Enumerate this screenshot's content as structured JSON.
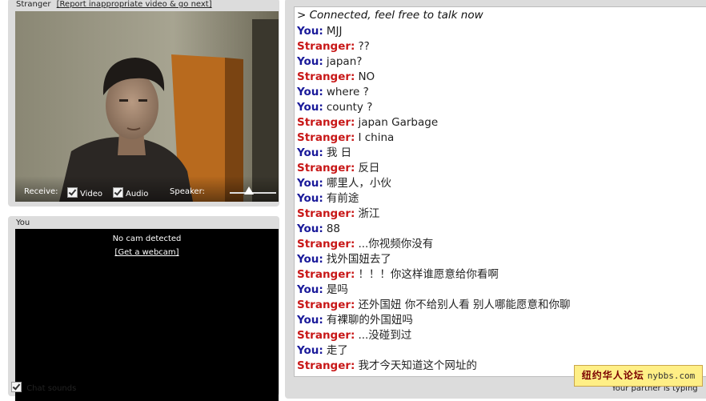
{
  "stranger_panel": {
    "label": "Stranger",
    "report_link": "[Report inappropriate video & go next]",
    "controls": {
      "receive_label": "Receive:",
      "video_label": "Video",
      "video_checked": true,
      "audio_label": "Audio",
      "audio_checked": true,
      "speaker_label": "Speaker:",
      "speaker_level": 0.4
    }
  },
  "you_panel": {
    "label": "You",
    "no_cam_text": "No cam detected",
    "webcam_link": "[Get a webcam]"
  },
  "chat": {
    "status": "> Connected, feel free to talk now",
    "messages": [
      {
        "sender": "You:",
        "role": "you",
        "text": "MJJ"
      },
      {
        "sender": "Stranger:",
        "role": "stranger",
        "text": "??"
      },
      {
        "sender": "You:",
        "role": "you",
        "text": "japan?"
      },
      {
        "sender": "Stranger:",
        "role": "stranger",
        "text": "NO"
      },
      {
        "sender": "You:",
        "role": "you",
        "text": "where ?"
      },
      {
        "sender": "You:",
        "role": "you",
        "text": "county ?"
      },
      {
        "sender": "Stranger:",
        "role": "stranger",
        "text": "japan  Garbage"
      },
      {
        "sender": "Stranger:",
        "role": "stranger",
        "text": "I  china"
      },
      {
        "sender": "You:",
        "role": "you",
        "text": "我 日"
      },
      {
        "sender": "Stranger:",
        "role": "stranger",
        "text": "反日"
      },
      {
        "sender": "You:",
        "role": "you",
        "text": "哪里人，小伙"
      },
      {
        "sender": "You:",
        "role": "you",
        "text": "有前途"
      },
      {
        "sender": "Stranger:",
        "role": "stranger",
        "text": "浙江"
      },
      {
        "sender": "You:",
        "role": "you",
        "text": "88"
      },
      {
        "sender": "Stranger:",
        "role": "stranger",
        "text": "...你视频你没有"
      },
      {
        "sender": "You:",
        "role": "you",
        "text": "找外国妞去了"
      },
      {
        "sender": "Stranger:",
        "role": "stranger",
        "text": "！！！你这样谁愿意给你看啊"
      },
      {
        "sender": "You:",
        "role": "you",
        "text": "是吗"
      },
      {
        "sender": "Stranger:",
        "role": "stranger",
        "text": "还外国妞  你不给别人看  别人哪能愿意和你聊"
      },
      {
        "sender": "You:",
        "role": "you",
        "text": "有裸聊的外国妞吗"
      },
      {
        "sender": "Stranger:",
        "role": "stranger",
        "text": "...没碰到过"
      },
      {
        "sender": "You:",
        "role": "you",
        "text": "走了"
      },
      {
        "sender": "Stranger:",
        "role": "stranger",
        "text": "我才今天知道这个网址的"
      }
    ],
    "chat_sounds_label": "Chat sounds",
    "chat_sounds_checked": true,
    "typing_text": "Your partner is typing"
  },
  "watermark": {
    "name": "纽约华人论坛",
    "url": "nybbs.com"
  },
  "colors": {
    "you": "#1a1a9a",
    "stranger": "#c81818",
    "panel": "#dcdcdc",
    "watermark_bg": "#ffef86"
  }
}
